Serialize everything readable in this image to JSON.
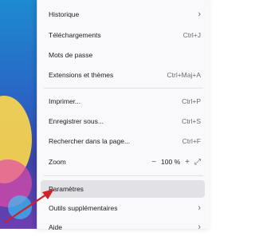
{
  "menu": {
    "history": {
      "label": "Historique",
      "chevron": "›"
    },
    "downloads": {
      "label": "Téléchargements",
      "shortcut": "Ctrl+J"
    },
    "passwords": {
      "label": "Mots de passe"
    },
    "extensions": {
      "label": "Extensions et thèmes",
      "shortcut": "Ctrl+Maj+A"
    },
    "print": {
      "label": "Imprimer...",
      "shortcut": "Ctrl+P"
    },
    "save": {
      "label": "Enregistrer sous...",
      "shortcut": "Ctrl+S"
    },
    "find": {
      "label": "Rechercher dans la page...",
      "shortcut": "Ctrl+F"
    },
    "zoom": {
      "label": "Zoom",
      "minus": "−",
      "value": "100 %",
      "plus": "+",
      "fullscreen_icon": "⤢"
    },
    "settings": {
      "label": "Paramètres"
    },
    "more_tools": {
      "label": "Outils supplémentaires",
      "chevron": "›"
    },
    "help": {
      "label": "Aide",
      "chevron": "›"
    }
  },
  "colors": {
    "arrow": "#d0202a",
    "hover": "#e2e2e6"
  }
}
